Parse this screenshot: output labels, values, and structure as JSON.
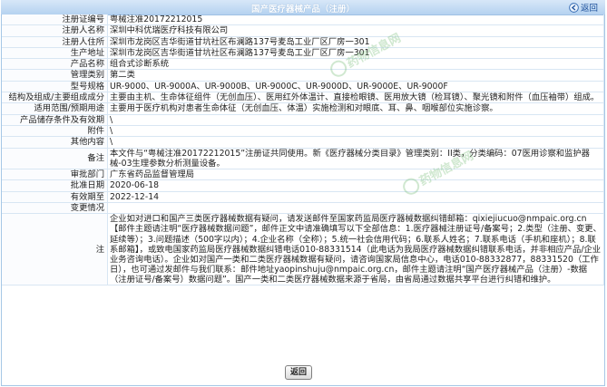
{
  "header": {
    "title": "国产医疗器械产品（注册）",
    "back_label": "返回"
  },
  "rows": [
    {
      "label": "注册证编号",
      "value": "粤械注准20172212015"
    },
    {
      "label": "注册人名称",
      "value": "深圳中科优瑞医疗科技有限公司"
    },
    {
      "label": "注册人住所",
      "value": "深圳市龙岗区吉华街道甘坑社区布澜路137号麦岛工业厂区厂房一301"
    },
    {
      "label": "生产地址",
      "value": "深圳市龙岗区吉华街道甘坑社区布澜路137号麦岛工业厂区厂房一301"
    },
    {
      "label": "产品名称",
      "value": "组合式诊断系统"
    },
    {
      "label": "管理类别",
      "value": "第二类"
    },
    {
      "label": "型号规格",
      "value": "UR-9000、UR-9000A、UR-9000B、UR-9000C、UR-9000D、UR-9000E、UR-9000F"
    },
    {
      "label": "结构及组成/主要组成成分",
      "value": "主要由主机、生命体征组件（无创血压）、医用红外体温计、直接检眼镜、医用放大镜（检耳镜）、聚光镜和附件（血压袖带）组成。"
    },
    {
      "label": "适用范围/预期用途",
      "value": "主要用于医疗机构对患者生命体征（无创血压、体温）实施检测和对眼底、耳、鼻、咽喉部位实施诊察。"
    },
    {
      "label": "产品储存条件及有效期",
      "value": "\\"
    },
    {
      "label": "附件",
      "value": "\\"
    },
    {
      "label": "其他内容",
      "value": "\\"
    },
    {
      "label": "备注",
      "value": "本文件与“粤械注准20172212015”注册证共同使用。新《医疗器械分类目录》管理类别：II类，分类编码：07医用诊察和监护器械-03生理参数分析测量设备。"
    },
    {
      "label": "审批部门",
      "value": "广东省药品监督管理局"
    },
    {
      "label": "批准日期",
      "value": "2020-06-18"
    },
    {
      "label": "有效期至",
      "value": "2022-12-14"
    },
    {
      "label": "变更情况",
      "value": ""
    },
    {
      "label": "注",
      "value": "企业如对进口和国产三类医疗器械数据有疑问，请发送邮件至国家药监局医疗器械数据纠错邮箱：qixiejiucuo@nmpaic.org.cn【邮件主题请注明“医疗器械数据问题”，邮件正文中请准确填写以下全部信息：1.医疗器械注册证号/备案号；2.类型（注册、变更、延续等）；3.问题描述（500字以内）；4.企业名称（全称）；5.统一社会信用代码；6.联系人姓名；7.联系电话（手机和座机）；8.联系邮箱】，或致电国家药监局医疗器械数据纠错电话010-88331514（此电话为我局医疗器械数据纠错联系电话，并非相应产品/企业业务咨询电话）。企业如对国产一类和二类医疗器械数据有疑问，请咨询国家局信息中心，电话010-88332877，88331520（工作日），也可通过发邮件与我们联系：邮件地址yaopinshuju@nmpaic.org.cn，邮件主题请注明“国产医疗器械产品（注册）-数据（注册证号/备案号）数据问题”。国产一类和二类医疗器械数据来源于省局，由省局通过数据共享平台进行纠错和维护。"
    }
  ],
  "watermark": "药物信息网"
}
